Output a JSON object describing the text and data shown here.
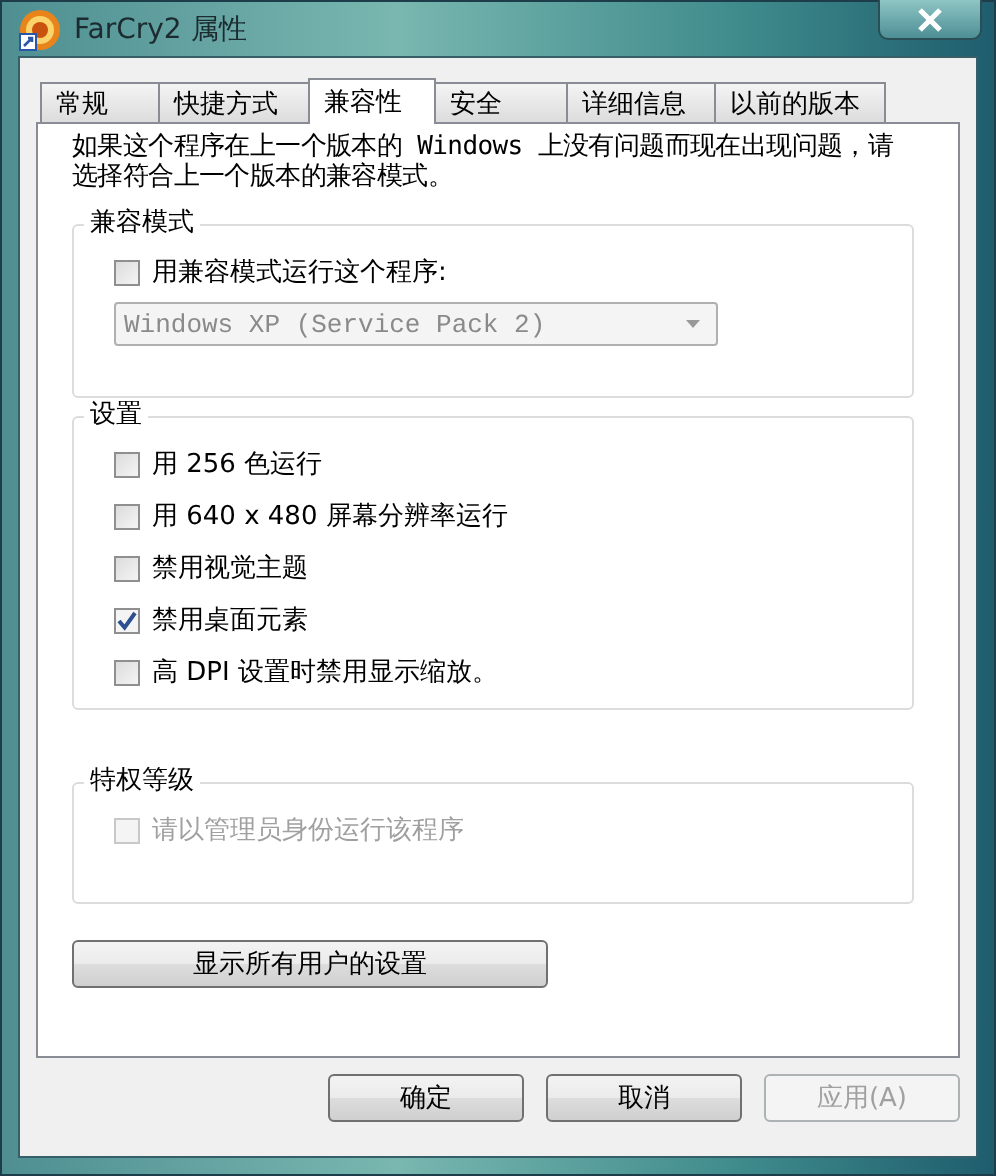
{
  "window": {
    "title": "FarCry2 属性"
  },
  "tabs": [
    {
      "label": "常规",
      "selected": false
    },
    {
      "label": "快捷方式",
      "selected": false
    },
    {
      "label": "兼容性",
      "selected": true
    },
    {
      "label": "安全",
      "selected": false
    },
    {
      "label": "详细信息",
      "selected": false
    },
    {
      "label": "以前的版本",
      "selected": false
    }
  ],
  "description": "如果这个程序在上一个版本的 Windows 上没有问题而现在出现问题，请选择符合上一个版本的兼容模式。",
  "groups": [
    {
      "title": "兼容模式",
      "items": [
        {
          "kind": "checkbox",
          "label": "用兼容模式运行这个程序:",
          "checked": false,
          "disabled": false
        },
        {
          "kind": "dropdown",
          "value": "Windows XP (Service Pack 2)",
          "disabled": true
        }
      ]
    },
    {
      "title": "设置",
      "items": [
        {
          "kind": "checkbox",
          "label": "用 256 色运行",
          "checked": false,
          "disabled": false
        },
        {
          "kind": "checkbox",
          "label": "用 640 x 480 屏幕分辨率运行",
          "checked": false,
          "disabled": false
        },
        {
          "kind": "checkbox",
          "label": "禁用视觉主题",
          "checked": false,
          "disabled": false
        },
        {
          "kind": "checkbox",
          "label": "禁用桌面元素",
          "checked": true,
          "disabled": false
        },
        {
          "kind": "checkbox",
          "label": "高 DPI 设置时禁用显示缩放。",
          "checked": false,
          "disabled": false
        }
      ]
    },
    {
      "title": "特权等级",
      "items": [
        {
          "kind": "checkbox",
          "label": "请以管理员身份运行该程序",
          "checked": false,
          "disabled": true
        }
      ]
    }
  ],
  "all_users_button": {
    "label": "显示所有用户的设置"
  },
  "buttons": [
    {
      "label": "确定",
      "disabled": false
    },
    {
      "label": "取消",
      "disabled": false
    },
    {
      "label": "应用(A)",
      "disabled": true
    }
  ]
}
